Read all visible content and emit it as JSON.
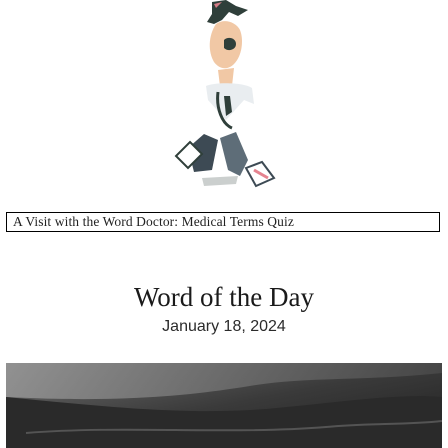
{
  "quiz": {
    "label": "A Visit with the Word Doctor: Medical Terms Quiz"
  },
  "word_of_the_day": {
    "title": "Word of the Day",
    "date": "January 18, 2024"
  },
  "icons": {
    "hero": "doctor-illustration",
    "bottom": "word-of-the-day-photo"
  }
}
